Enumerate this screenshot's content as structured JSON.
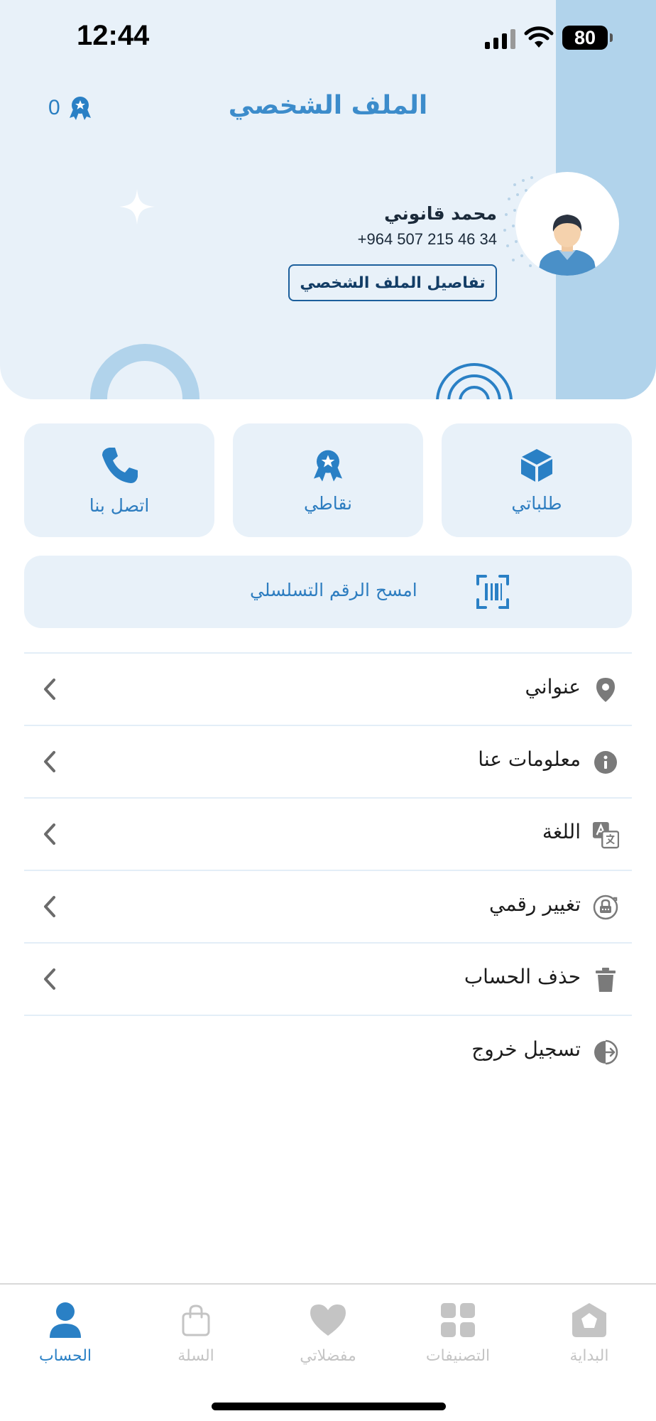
{
  "status_bar": {
    "time": "12:44",
    "battery": "80"
  },
  "header": {
    "title": "الملف الشخصي",
    "points_count": "0"
  },
  "profile": {
    "name": "محمد قانوني",
    "phone": "+964 507 215 46 34",
    "details_button": "تفاصيل الملف الشخصي"
  },
  "tiles": [
    {
      "label": "طلباتي",
      "icon": "box-icon"
    },
    {
      "label": "نقاطي",
      "icon": "award-icon"
    },
    {
      "label": "اتصل بنا",
      "icon": "phone-icon"
    }
  ],
  "scan": {
    "label": "امسح الرقم التسلسلي",
    "icon": "barcode-scan-icon"
  },
  "menu": [
    {
      "label": "عنواني",
      "icon": "location-pin-icon"
    },
    {
      "label": "معلومات عنا",
      "icon": "info-icon"
    },
    {
      "label": "اللغة",
      "icon": "translate-icon"
    },
    {
      "label": "تغيير رقمي",
      "icon": "phone-lock-icon"
    },
    {
      "label": "حذف الحساب",
      "icon": "trash-icon"
    },
    {
      "label": "تسجيل خروج",
      "icon": "logout-icon"
    }
  ],
  "bottom_nav": [
    {
      "label": "البداية",
      "icon": "home-icon",
      "active": false
    },
    {
      "label": "التصنيفات",
      "icon": "grid-icon",
      "active": false
    },
    {
      "label": "مفضلاتي",
      "icon": "heart-icon",
      "active": false
    },
    {
      "label": "السلة",
      "icon": "bag-icon",
      "active": false
    },
    {
      "label": "الحساب",
      "icon": "user-icon",
      "active": true
    }
  ],
  "colors": {
    "accent": "#2a80c5",
    "header_bg": "#e8f1f9",
    "header_stripe": "#b1d3eb",
    "inactive": "#c4c4c4"
  }
}
